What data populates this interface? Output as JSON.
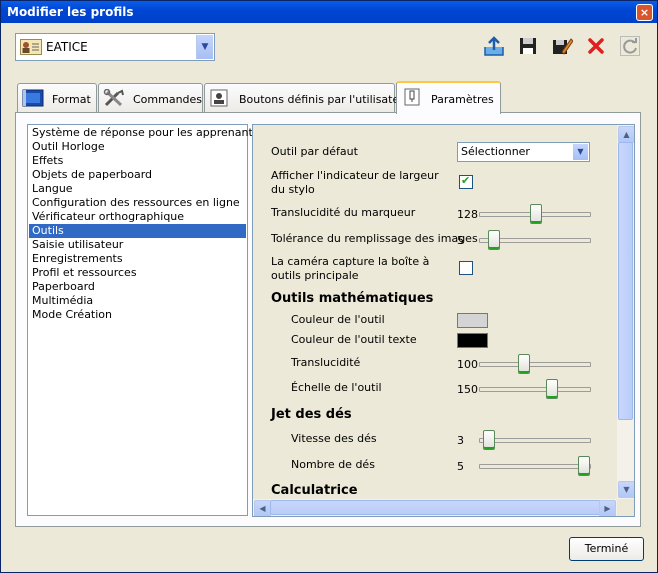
{
  "window": {
    "title": "Modifier les profils",
    "close_label": "×"
  },
  "profile_combo": {
    "value": "EATICE",
    "arrow": "▼"
  },
  "toolbar": [
    {
      "name": "export-icon",
      "color": "#2a7fd4"
    },
    {
      "name": "save-icon",
      "color": "#222222"
    },
    {
      "name": "edit-icon",
      "color": "#222222"
    },
    {
      "name": "delete-icon",
      "color": "#e03030"
    },
    {
      "name": "refresh-icon",
      "color": "#999999"
    }
  ],
  "tabs": [
    {
      "label": "Format",
      "icon": "format-icon",
      "active": false
    },
    {
      "label": "Commandes",
      "icon": "tools-icon",
      "active": false
    },
    {
      "label": "Boutons définis par l'utilisateur",
      "icon": "user-button-icon",
      "active": false
    },
    {
      "label": "Paramètres",
      "icon": "settings-icon",
      "active": true
    }
  ],
  "categories": [
    "Système de réponse pour les apprenants",
    "Outil Horloge",
    "Effets",
    "Objets de paperboard",
    "Langue",
    "Configuration des ressources en ligne",
    "Vérificateur orthographique",
    "Outils",
    "Saisie utilisateur",
    "Enregistrements",
    "Profil et ressources",
    "Paperboard",
    "Multimédia",
    "Mode Création"
  ],
  "selected_category": "Outils",
  "settings": {
    "default_tool": {
      "label": "Outil par défaut",
      "value": "Sélectionner",
      "arrow": "▼"
    },
    "width_indicator": {
      "label": "Afficher l'indicateur de largeur du stylo",
      "checked": true,
      "mark": "✔"
    },
    "marker_translucency": {
      "label": "Translucidité du marqueur",
      "value": "128",
      "fraction": 0.5
    },
    "fill_tolerance": {
      "label": "Tolérance du remplissage des images",
      "value": "5",
      "fraction": 0.09
    },
    "camera_capture": {
      "label": "La caméra capture la boîte à outils principale",
      "checked": false
    },
    "math_tools": {
      "header": "Outils mathématiques",
      "tool_color": {
        "label": "Couleur de l'outil",
        "color": "#d4d4d4"
      },
      "text_color": {
        "label": "Couleur de l'outil texte",
        "color": "#000000"
      },
      "translucency": {
        "label": "Translucidité",
        "value": "100",
        "fraction": 0.38
      },
      "scale": {
        "label": "Échelle de l'outil",
        "value": "150",
        "fraction": 0.66
      }
    },
    "dice": {
      "header": "Jet des dés",
      "speed": {
        "label": "Vitesse des dés",
        "value": "3",
        "fraction": 0.04
      },
      "count": {
        "label": "Nombre de dés",
        "value": "5",
        "fraction": 0.97
      }
    },
    "calculator": {
      "header": "Calculatrice"
    }
  },
  "scroll": {
    "up": "▲",
    "down": "▼",
    "left": "◀",
    "right": "▶",
    "vertical_fraction": 0.0,
    "horizontal_fraction": 0.0
  },
  "done_button": "Terminé"
}
